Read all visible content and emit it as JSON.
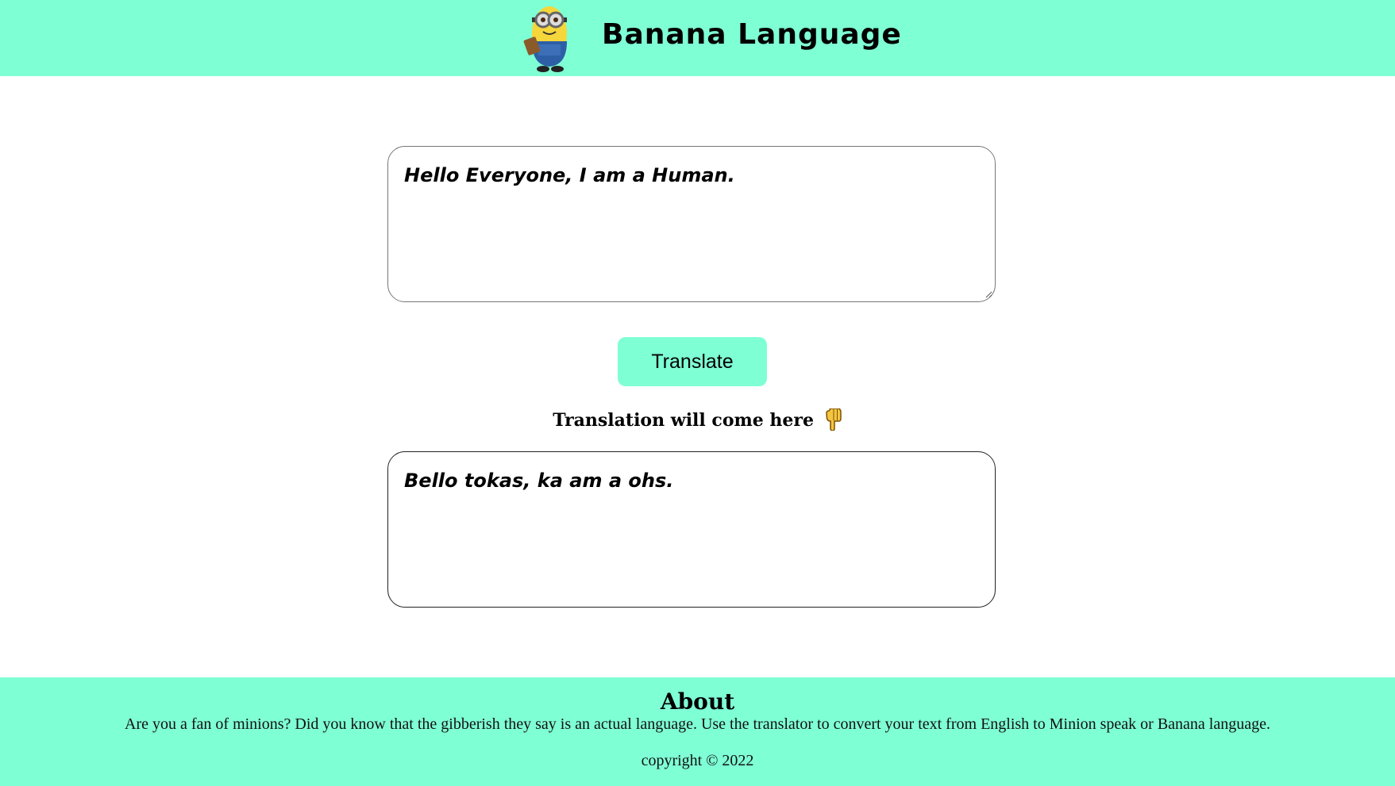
{
  "header": {
    "title": "Banana Language",
    "logo_icon": "minion-icon"
  },
  "input": {
    "value": "Hello Everyone, I am a Human."
  },
  "translate_button": {
    "label": "Translate"
  },
  "hint": {
    "text": "Translation will come here",
    "icon": "pointing-down-hand-icon"
  },
  "output": {
    "value": "Bello tokas, ka am a ohs."
  },
  "footer": {
    "heading": "About",
    "text": "Are you a fan of minions? Did you know that the gibberish they say is an actual language. Use the translator to convert your text from English to Minion speak or Banana language.",
    "copyright": "copyright © 2022"
  },
  "colors": {
    "accent": "#7fffd4",
    "text": "#000000"
  }
}
